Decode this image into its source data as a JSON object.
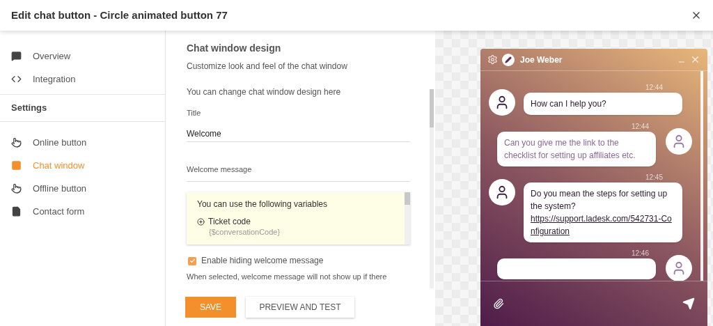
{
  "window": {
    "title": "Edit chat button - Circle animated button 77"
  },
  "sidebar": {
    "items": [
      {
        "label": "Overview",
        "kind": "chat",
        "selected": false
      },
      {
        "label": "Integration",
        "kind": "code",
        "selected": false
      }
    ],
    "section": "Settings",
    "settings_items": [
      {
        "label": "Online button",
        "kind": "hand",
        "selected": false
      },
      {
        "label": "Chat window",
        "kind": "window",
        "selected": true
      },
      {
        "label": "Offline button",
        "kind": "hand",
        "selected": false
      },
      {
        "label": "Contact form",
        "kind": "form",
        "selected": false
      }
    ]
  },
  "form": {
    "heading": "Chat window design",
    "subheading": "Customize look and feel of the chat window",
    "intro": "You can change chat window design here",
    "title_field": {
      "label": "Title",
      "value": "Welcome"
    },
    "welcome_field": {
      "placeholder": "Welcome message"
    },
    "variables": {
      "heading": "You can use the following variables",
      "items": [
        {
          "label": "Ticket code",
          "code": "{$conversationCode}"
        }
      ]
    },
    "hide_checkbox": {
      "label": "Enable hiding welcome message",
      "checked": true
    },
    "hint": "When selected, welcome message will not show up if there",
    "buttons": [
      {
        "label": "SAVE",
        "kind": "primary"
      },
      {
        "label": "PREVIEW AND TEST",
        "kind": "secondary"
      }
    ]
  },
  "preview": {
    "agent_name": "Joe Weber",
    "messages": [
      {
        "kind": "agent",
        "time": "12:44",
        "text": "How can I help you?"
      },
      {
        "kind": "visitor",
        "time": "12:44",
        "text": "Can you give me the link to the checklist for setting up affiliates etc."
      },
      {
        "kind": "agent",
        "time": "12:45",
        "text": "Do you mean the steps for setting up the system?",
        "link": "https://support.ladesk.com/542731-Configuration"
      },
      {
        "kind": "visitor",
        "time": "12:46"
      }
    ]
  }
}
